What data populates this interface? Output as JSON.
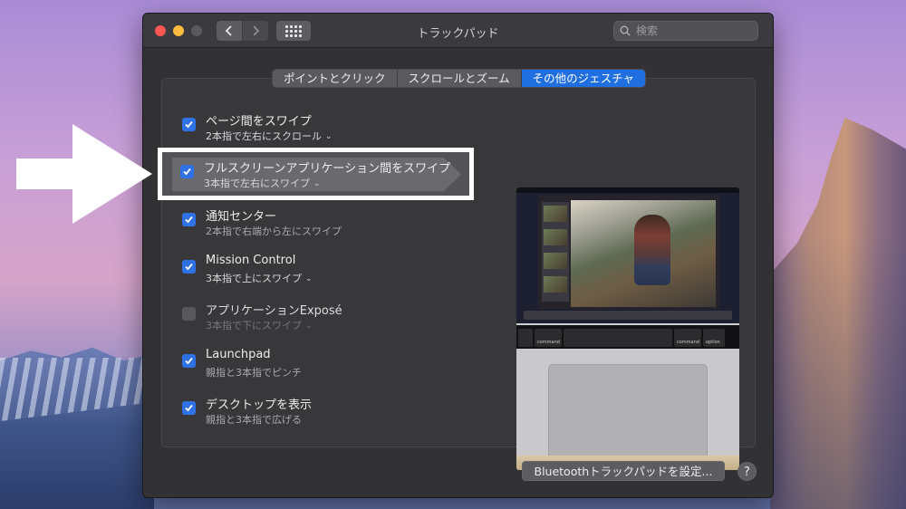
{
  "window": {
    "title": "トラックパッド",
    "search_placeholder": "検索"
  },
  "tabs": [
    {
      "label": "ポイントとクリック",
      "active": false
    },
    {
      "label": "スクロールとズーム",
      "active": false
    },
    {
      "label": "その他のジェスチャ",
      "active": true
    }
  ],
  "gestures": [
    {
      "title": "ページ間をスワイプ",
      "subtitle": "2本指で左右にスクロール",
      "checked": true,
      "has_menu": true
    },
    {
      "title": "フルスクリーンアプリケーション間をスワイプ",
      "subtitle": "3本指で左右にスワイプ",
      "checked": true,
      "has_menu": true,
      "highlighted": true
    },
    {
      "title": "通知センター",
      "subtitle": "2本指で右端から左にスワイプ",
      "checked": true,
      "has_menu": false
    },
    {
      "title": "Mission Control",
      "subtitle": "3本指で上にスワイプ",
      "checked": true,
      "has_menu": true
    },
    {
      "title": "アプリケーションExposé",
      "subtitle": "3本指で下にスワイプ",
      "checked": false,
      "has_menu": true,
      "disabled": true
    },
    {
      "title": "Launchpad",
      "subtitle": "親指と3本指でピンチ",
      "checked": true,
      "has_menu": false
    },
    {
      "title": "デスクトップを表示",
      "subtitle": "親指と3本指で広げる",
      "checked": true,
      "has_menu": false
    }
  ],
  "preview": {
    "keys": [
      "option",
      "command",
      "command",
      "option"
    ]
  },
  "footer": {
    "bluetooth_button": "Bluetoothトラックパッドを設定...",
    "help_label": "?"
  },
  "colors": {
    "accent": "#1f6fe1",
    "checkbox": "#2e72e6",
    "close": "#fc5753",
    "minimize": "#fdbc40"
  }
}
